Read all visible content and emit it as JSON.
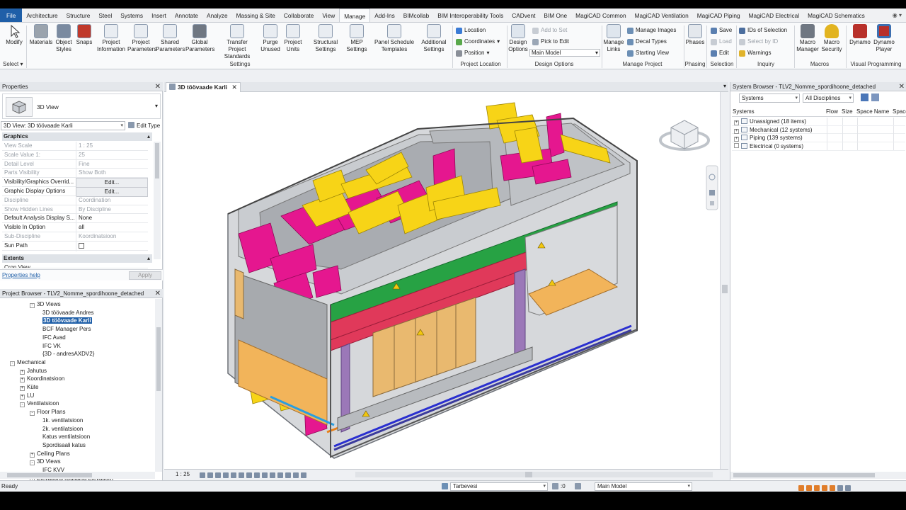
{
  "ribbon_tabs": [
    "File",
    "Architecture",
    "Structure",
    "Steel",
    "Systems",
    "Insert",
    "Annotate",
    "Analyze",
    "Massing & Site",
    "Collaborate",
    "View",
    "Manage",
    "Add-Ins",
    "BIMcollab",
    "BIM Interoperability Tools",
    "CADvent",
    "BIM One",
    "MagiCAD Common",
    "MagiCAD Ventilation",
    "MagiCAD Piping",
    "MagiCAD Electrical",
    "MagiCAD Schematics"
  ],
  "active_tab": "Manage",
  "tab_controls": "◉ ▾",
  "ribbon": {
    "select": {
      "modify": "Modify",
      "select": "Select"
    },
    "settings": {
      "buttons": [
        {
          "label": "Materials"
        },
        {
          "label": "Object\nStyles"
        },
        {
          "label": "Snaps"
        },
        {
          "label": "Project\nInformation"
        },
        {
          "label": "Project\nParameters"
        },
        {
          "label": "Shared\nParameters"
        },
        {
          "label": "Global\nParameters"
        },
        {
          "label": "Transfer\nProject Standards"
        },
        {
          "label": "Purge\nUnused"
        },
        {
          "label": "Project\nUnits"
        },
        {
          "label": "Structural\nSettings"
        },
        {
          "label": "MEP\nSettings"
        },
        {
          "label": "Panel Schedule\nTemplates"
        },
        {
          "label": "Additional\nSettings"
        }
      ],
      "group": "Settings"
    },
    "location": {
      "items": [
        "Location",
        "Coordinates",
        "Position"
      ],
      "group": "Project Location"
    },
    "design_options": {
      "button": "Design\nOptions",
      "add_to_set": "Add to Set",
      "pick_to_edit": "Pick to Edit",
      "main_model": "Main Model",
      "group": "Design Options"
    },
    "manage_project": {
      "manage_links": "Manage\nLinks",
      "manage_images": "Manage  Images",
      "decal_types": "Decal  Types",
      "starting_view": "Starting  View",
      "group": "Manage Project"
    },
    "phasing": {
      "phases": "Phases",
      "group": "Phasing"
    },
    "selection": {
      "save": "Save",
      "load": "Load",
      "edit": "Edit",
      "group": "Selection"
    },
    "inquiry": {
      "ids": "IDs of  Selection",
      "select_by_id": "Select  by ID",
      "warnings": "Warnings",
      "group": "Inquiry"
    },
    "macros": {
      "macro_manager": "Macro\nManager",
      "macro_security": "Macro\nSecurity",
      "group": "Macros"
    },
    "visual_programming": {
      "dynamo": "Dynamo",
      "dynamo_player": "Dynamo\nPlayer",
      "group": "Visual Programming"
    }
  },
  "properties": {
    "title": "Properties",
    "type_name": "3D View",
    "instance_selector": "3D View: 3D töövaade Karli",
    "edit_type": "Edit Type",
    "section_graphics": "Graphics",
    "rows": [
      {
        "label": "View Scale",
        "value": "1 : 25",
        "dim": true
      },
      {
        "label": "Scale Value    1:",
        "value": "25",
        "dim": true
      },
      {
        "label": "Detail Level",
        "value": "Fine",
        "dim": true
      },
      {
        "label": "Parts Visibility",
        "value": "Show Both",
        "dim": true
      },
      {
        "label": "Visibility/Graphics Overrid...",
        "value": "Edit...",
        "button": true
      },
      {
        "label": "Graphic Display Options",
        "value": "Edit...",
        "button": true
      },
      {
        "label": "Discipline",
        "value": "Coordination",
        "dim": true
      },
      {
        "label": "Show Hidden Lines",
        "value": "By Discipline",
        "dim": true
      },
      {
        "label": "Default Analysis Display S...",
        "value": "None"
      },
      {
        "label": "Visible In Option",
        "value": "all"
      },
      {
        "label": "Sub-Discipline",
        "value": "Koordinatsioon",
        "dim": true
      },
      {
        "label": "Sun Path",
        "value": ""
      }
    ],
    "section_extents": "Extents",
    "crop_view": "Crop View",
    "help": "Properties help",
    "apply": "Apply"
  },
  "project_browser": {
    "title": "Project Browser - TLV2_Nomme_spordihoone_detached",
    "nodes": [
      {
        "label": "3D Views",
        "indent": 2,
        "toggle": "-"
      },
      {
        "label": "3D töövaade Andres",
        "indent": 3
      },
      {
        "label": "3D töövaade Karli",
        "indent": 3,
        "selected": true
      },
      {
        "label": "BCF Manager Pers",
        "indent": 3
      },
      {
        "label": "IFC Avad",
        "indent": 3
      },
      {
        "label": "IFC VK",
        "indent": 3
      },
      {
        "label": "{3D - andresAXDV2}",
        "indent": 3
      },
      {
        "label": "Mechanical",
        "indent": 0,
        "toggle": "-"
      },
      {
        "label": "Jahutus",
        "indent": 1,
        "toggle": "+"
      },
      {
        "label": "Koordinatsioon",
        "indent": 1,
        "toggle": "+"
      },
      {
        "label": "Küte",
        "indent": 1,
        "toggle": "+"
      },
      {
        "label": "LU",
        "indent": 1,
        "toggle": "+"
      },
      {
        "label": "Ventilatsioon",
        "indent": 1,
        "toggle": "-"
      },
      {
        "label": "Floor Plans",
        "indent": 2,
        "toggle": "-"
      },
      {
        "label": "1k. ventilatsioon",
        "indent": 3
      },
      {
        "label": "2k. ventilatsioon",
        "indent": 3
      },
      {
        "label": "Katus ventilatsioon",
        "indent": 3
      },
      {
        "label": "Spordisaali katus",
        "indent": 3
      },
      {
        "label": "Ceiling Plans",
        "indent": 2,
        "toggle": "+"
      },
      {
        "label": "3D Views",
        "indent": 2,
        "toggle": "-"
      },
      {
        "label": "IFC KVV",
        "indent": 3
      },
      {
        "label": "Elevations (Building Elevation)",
        "indent": 2,
        "toggle": "+"
      }
    ]
  },
  "view": {
    "tab_label": "3D töövaade Karli",
    "scale": "1 : 25"
  },
  "system_browser": {
    "title": "System Browser - TLV2_Nomme_spordihoone_detached",
    "filter": "Systems",
    "discipline": "All Disciplines",
    "columns": [
      "Systems",
      "Flow",
      "Size",
      "Space Name",
      "Space"
    ],
    "rows": [
      "Unassigned (18 items)",
      "Mechanical (12 systems)",
      "Piping (139 systems)",
      "Electrical (0 systems)"
    ]
  },
  "status": {
    "text": "Ready",
    "workset": "Tarbevesi",
    "zero": ":0",
    "model": "Main Model"
  }
}
